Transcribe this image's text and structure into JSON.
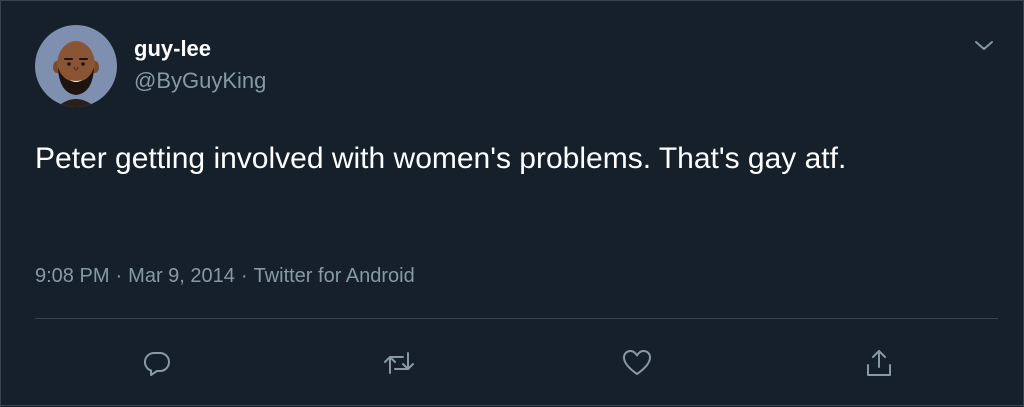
{
  "user": {
    "display_name": "guy-lee",
    "handle": "@ByGuyKing",
    "avatar_icon": "cartoon-bearded-man-avatar"
  },
  "tweet": {
    "text": "Peter getting involved with women's problems. That's gay atf."
  },
  "meta": {
    "time": "9:08 PM",
    "date": "Mar 9, 2014",
    "source": "Twitter for Android",
    "separator": "·"
  },
  "actions": {
    "reply_icon": "reply-icon",
    "retweet_icon": "retweet-icon",
    "like_icon": "heart-icon",
    "share_icon": "share-icon",
    "menu_icon": "chevron-down-icon"
  },
  "colors": {
    "background": "#15202b",
    "text_primary": "#ffffff",
    "text_secondary": "#8899a6",
    "border": "#38444d",
    "avatar_bg": "#7f8fb0"
  }
}
